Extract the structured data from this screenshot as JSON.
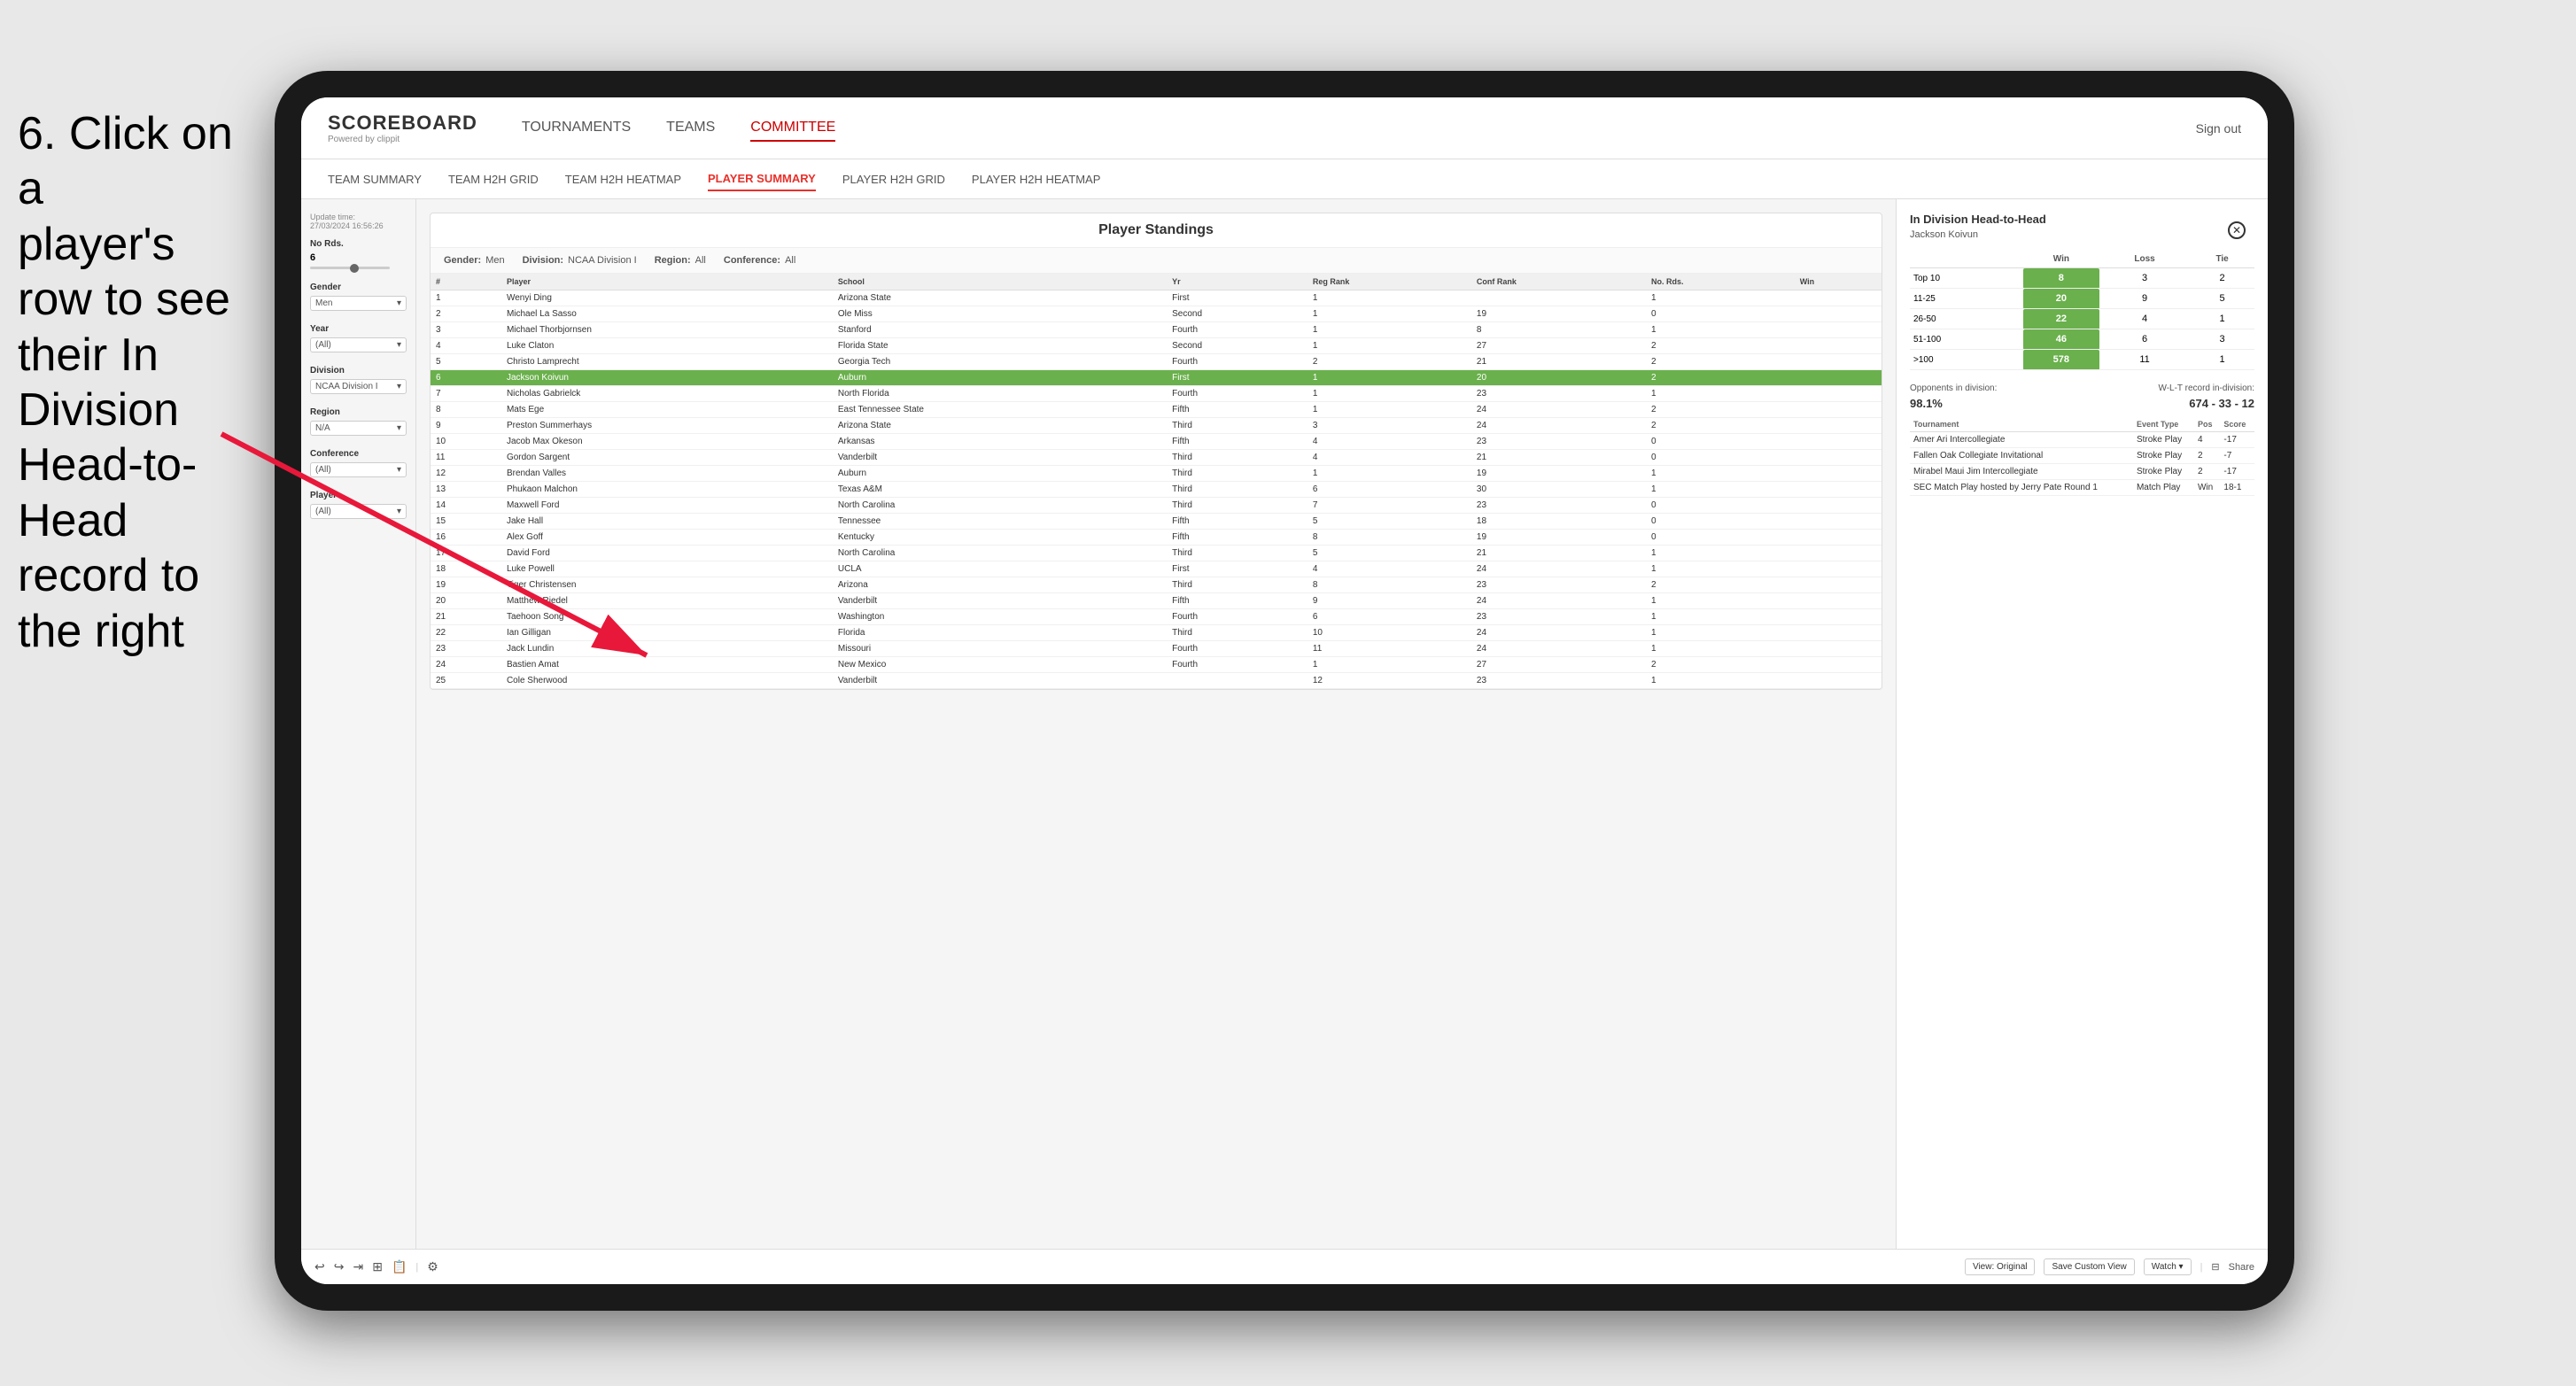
{
  "instruction": {
    "line1": "6. Click on a",
    "line2": "player's row to see",
    "line3": "their In Division",
    "line4": "Head-to-Head",
    "line5": "record to the right"
  },
  "nav": {
    "logo": "SCOREBOARD",
    "powered": "Powered by clippit",
    "items": [
      "TOURNAMENTS",
      "TEAMS",
      "COMMITTEE"
    ],
    "sign_out": "Sign out"
  },
  "sub_nav": {
    "items": [
      "TEAM SUMMARY",
      "TEAM H2H GRID",
      "TEAM H2H HEATMAP",
      "PLAYER SUMMARY",
      "PLAYER H2H GRID",
      "PLAYER H2H HEATMAP"
    ],
    "active": "PLAYER SUMMARY"
  },
  "sidebar": {
    "update_time_label": "Update time:",
    "update_time": "27/03/2024 16:56:26",
    "no_rds_label": "No Rds.",
    "no_rds_value": "6",
    "gender_label": "Gender",
    "gender_value": "Men",
    "year_label": "Year",
    "year_value": "(All)",
    "division_label": "Division",
    "division_value": "NCAA Division I",
    "region_label": "Region",
    "region_value": "N/A",
    "conference_label": "Conference",
    "conference_value": "(All)",
    "player_label": "Player",
    "player_value": "(All)"
  },
  "standings": {
    "title": "Player Standings",
    "filters": {
      "gender_label": "Gender:",
      "gender_value": "Men",
      "division_label": "Division:",
      "division_value": "NCAA Division I",
      "region_label": "Region:",
      "region_value": "All",
      "conference_label": "Conference:",
      "conference_value": "All"
    },
    "columns": [
      "#",
      "Player",
      "School",
      "Yr",
      "Reg Rank",
      "Conf Rank",
      "No. Rds.",
      "Win"
    ],
    "rows": [
      {
        "num": "1",
        "player": "Wenyi Ding",
        "school": "Arizona State",
        "yr": "First",
        "reg": "1",
        "conf": "",
        "rds": "1",
        "win": ""
      },
      {
        "num": "2",
        "player": "Michael La Sasso",
        "school": "Ole Miss",
        "yr": "Second",
        "reg": "1",
        "conf": "19",
        "rds": "0",
        "win": ""
      },
      {
        "num": "3",
        "player": "Michael Thorbjornsen",
        "school": "Stanford",
        "yr": "Fourth",
        "reg": "1",
        "conf": "8",
        "rds": "1",
        "win": ""
      },
      {
        "num": "4",
        "player": "Luke Claton",
        "school": "Florida State",
        "yr": "Second",
        "reg": "1",
        "conf": "27",
        "rds": "2",
        "win": ""
      },
      {
        "num": "5",
        "player": "Christo Lamprecht",
        "school": "Georgia Tech",
        "yr": "Fourth",
        "reg": "2",
        "conf": "21",
        "rds": "2",
        "win": ""
      },
      {
        "num": "6",
        "player": "Jackson Koivun",
        "school": "Auburn",
        "yr": "First",
        "reg": "1",
        "conf": "20",
        "rds": "2",
        "win": "",
        "highlighted": true
      },
      {
        "num": "7",
        "player": "Nicholas Gabrielck",
        "school": "North Florida",
        "yr": "Fourth",
        "reg": "1",
        "conf": "23",
        "rds": "1",
        "win": ""
      },
      {
        "num": "8",
        "player": "Mats Ege",
        "school": "East Tennessee State",
        "yr": "Fifth",
        "reg": "1",
        "conf": "24",
        "rds": "2",
        "win": ""
      },
      {
        "num": "9",
        "player": "Preston Summerhays",
        "school": "Arizona State",
        "yr": "Third",
        "reg": "3",
        "conf": "24",
        "rds": "2",
        "win": ""
      },
      {
        "num": "10",
        "player": "Jacob Max Okeson",
        "school": "Arkansas",
        "yr": "Fifth",
        "reg": "4",
        "conf": "23",
        "rds": "0",
        "win": ""
      },
      {
        "num": "11",
        "player": "Gordon Sargent",
        "school": "Vanderbilt",
        "yr": "Third",
        "reg": "4",
        "conf": "21",
        "rds": "0",
        "win": ""
      },
      {
        "num": "12",
        "player": "Brendan Valles",
        "school": "Auburn",
        "yr": "Third",
        "reg": "1",
        "conf": "19",
        "rds": "1",
        "win": ""
      },
      {
        "num": "13",
        "player": "Phukaon Malchon",
        "school": "Texas A&M",
        "yr": "Third",
        "reg": "6",
        "conf": "30",
        "rds": "1",
        "win": ""
      },
      {
        "num": "14",
        "player": "Maxwell Ford",
        "school": "North Carolina",
        "yr": "Third",
        "reg": "7",
        "conf": "23",
        "rds": "0",
        "win": ""
      },
      {
        "num": "15",
        "player": "Jake Hall",
        "school": "Tennessee",
        "yr": "Fifth",
        "reg": "5",
        "conf": "18",
        "rds": "0",
        "win": ""
      },
      {
        "num": "16",
        "player": "Alex Goff",
        "school": "Kentucky",
        "yr": "Fifth",
        "reg": "8",
        "conf": "19",
        "rds": "0",
        "win": ""
      },
      {
        "num": "17",
        "player": "David Ford",
        "school": "North Carolina",
        "yr": "Third",
        "reg": "5",
        "conf": "21",
        "rds": "1",
        "win": ""
      },
      {
        "num": "18",
        "player": "Luke Powell",
        "school": "UCLA",
        "yr": "First",
        "reg": "4",
        "conf": "24",
        "rds": "1",
        "win": ""
      },
      {
        "num": "19",
        "player": "Tiger Christensen",
        "school": "Arizona",
        "yr": "Third",
        "reg": "8",
        "conf": "23",
        "rds": "2",
        "win": ""
      },
      {
        "num": "20",
        "player": "Matthew Riedel",
        "school": "Vanderbilt",
        "yr": "Fifth",
        "reg": "9",
        "conf": "24",
        "rds": "1",
        "win": ""
      },
      {
        "num": "21",
        "player": "Taehoon Song",
        "school": "Washington",
        "yr": "Fourth",
        "reg": "6",
        "conf": "23",
        "rds": "1",
        "win": ""
      },
      {
        "num": "22",
        "player": "Ian Gilligan",
        "school": "Florida",
        "yr": "Third",
        "reg": "10",
        "conf": "24",
        "rds": "1",
        "win": ""
      },
      {
        "num": "23",
        "player": "Jack Lundin",
        "school": "Missouri",
        "yr": "Fourth",
        "reg": "11",
        "conf": "24",
        "rds": "1",
        "win": ""
      },
      {
        "num": "24",
        "player": "Bastien Amat",
        "school": "New Mexico",
        "yr": "Fourth",
        "reg": "1",
        "conf": "27",
        "rds": "2",
        "win": ""
      },
      {
        "num": "25",
        "player": "Cole Sherwood",
        "school": "Vanderbilt",
        "yr": "",
        "reg": "12",
        "conf": "23",
        "rds": "1",
        "win": ""
      }
    ]
  },
  "h2h_panel": {
    "title": "In Division Head-to-Head",
    "player_name": "Jackson Koivun",
    "table": {
      "headers": [
        "",
        "Win",
        "Loss",
        "Tie"
      ],
      "rows": [
        {
          "range": "Top 10",
          "win": "8",
          "loss": "3",
          "tie": "2"
        },
        {
          "range": "11-25",
          "win": "20",
          "loss": "9",
          "tie": "5"
        },
        {
          "range": "26-50",
          "win": "22",
          "loss": "4",
          "tie": "1"
        },
        {
          "range": "51-100",
          "win": "46",
          "loss": "6",
          "tie": "3"
        },
        {
          "range": ">100",
          "win": "578",
          "loss": "11",
          "tie": "1"
        }
      ]
    },
    "opponents_label": "Opponents in division:",
    "wlt_label": "W-L-T record in-division:",
    "opponents_pct": "98.1%",
    "wlt_record": "674 - 33 - 12",
    "tournaments": {
      "headers": [
        "Tournament",
        "Event Type",
        "Pos",
        "Score"
      ],
      "rows": [
        {
          "tournament": "Amer Ari Intercollegiate",
          "type": "Stroke Play",
          "pos": "4",
          "score": "-17"
        },
        {
          "tournament": "Fallen Oak Collegiate Invitational",
          "type": "Stroke Play",
          "pos": "2",
          "score": "-7"
        },
        {
          "tournament": "Mirabel Maui Jim Intercollegiate",
          "type": "Stroke Play",
          "pos": "2",
          "score": "-17"
        },
        {
          "tournament": "SEC Match Play hosted by Jerry Pate Round 1",
          "type": "Match Play",
          "pos": "Win",
          "score": "18-1"
        }
      ]
    }
  },
  "toolbar": {
    "view_original": "View: Original",
    "save_custom": "Save Custom View",
    "watch": "Watch ▾",
    "share": "Share"
  }
}
